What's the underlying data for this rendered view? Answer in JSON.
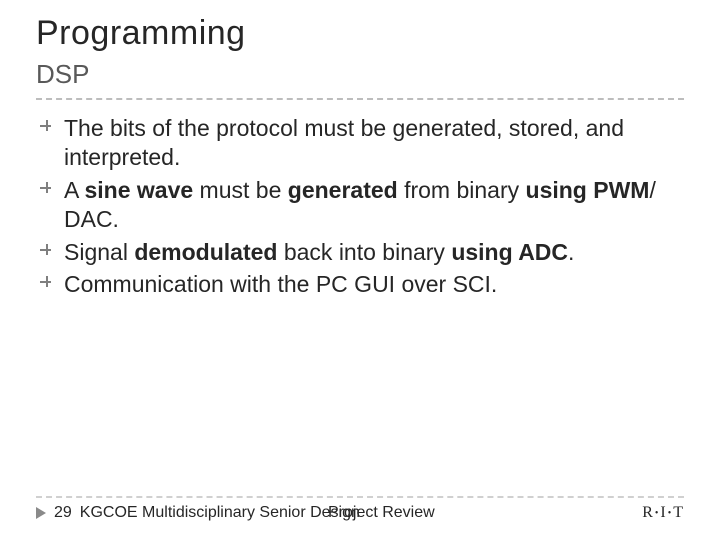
{
  "title": "Programming",
  "subtitle": "DSP",
  "bullets": [
    {
      "html": "The  bits of the protocol must be generated, stored, and interpreted."
    },
    {
      "html": "A <b>sine wave</b> must be <b>generated</b> from binary <b>using PWM</b>/ DAC."
    },
    {
      "html": "Signal <b>demodulated</b> back into binary <b>using ADC</b>."
    },
    {
      "html": "Communication with the PC GUI over SCI."
    }
  ],
  "footer": {
    "page": "29",
    "left": "KGCOE Multidisciplinary Senior Design",
    "center": "Project Review",
    "right_html": "R<span class=\"dot\">•</span>I<span class=\"dot\">•</span>T"
  }
}
